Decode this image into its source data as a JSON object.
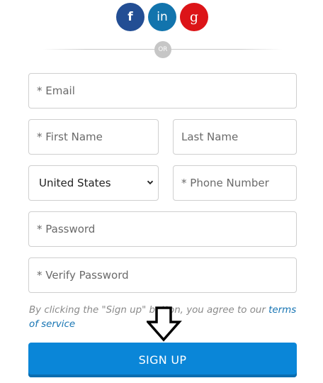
{
  "social": {
    "facebook": {
      "glyph": "f",
      "color": "#234e94",
      "icon": "facebook-icon"
    },
    "linkedin": {
      "glyph": "in",
      "color": "#1274ad",
      "icon": "linkedin-icon"
    },
    "google": {
      "glyph": "g",
      "color": "#dc1418",
      "icon": "google-plus-icon"
    }
  },
  "divider": {
    "or_label": "OR"
  },
  "form": {
    "email_placeholder": "* Email",
    "first_name_placeholder": "* First Name",
    "last_name_placeholder": "Last Name",
    "country_selected": "United States",
    "phone_placeholder": "* Phone Number",
    "password_placeholder": "* Password",
    "verify_password_placeholder": "* Verify Password"
  },
  "terms": {
    "text": "By clicking the \"Sign up\" button, you agree to our",
    "link": "terms of service"
  },
  "annotation": {
    "icon": "down-arrow-icon"
  },
  "signup": {
    "label": "SIGN UP",
    "color": "#0a86d8"
  }
}
